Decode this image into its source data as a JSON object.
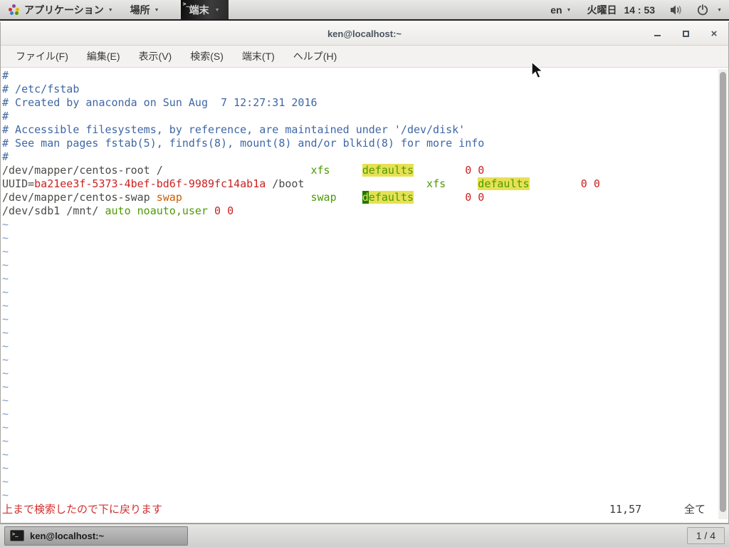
{
  "top_panel": {
    "applications_label": "アプリケーション",
    "places_label": "場所",
    "terminal_label": "端末",
    "language": "en",
    "day": "火曜日",
    "time": "14 : 53"
  },
  "icons": {
    "dropdown": "▼",
    "close": "×",
    "applications": "applications-grid-icon",
    "terminal": "terminal-icon",
    "speaker": "speaker-icon",
    "power": "power-icon"
  },
  "window": {
    "title": "ken@localhost:~"
  },
  "menubar": {
    "items": [
      "ファイル(F)",
      "編集(E)",
      "表示(V)",
      "検索(S)",
      "端末(T)",
      "ヘルプ(H)"
    ]
  },
  "terminal": {
    "lines": [
      {
        "segments": [
          {
            "text": "#",
            "style": "comment"
          }
        ]
      },
      {
        "segments": [
          {
            "text": "# /etc/fstab",
            "style": "comment"
          }
        ]
      },
      {
        "segments": [
          {
            "text": "# Created by anaconda on Sun Aug  7 12:27:31 2016",
            "style": "comment"
          }
        ]
      },
      {
        "segments": [
          {
            "text": "#",
            "style": "comment"
          }
        ]
      },
      {
        "segments": [
          {
            "text": "# Accessible filesystems, by reference, are maintained under '/dev/disk'",
            "style": "comment"
          }
        ]
      },
      {
        "segments": [
          {
            "text": "# See man pages fstab(5), findfs(8), mount(8) and/or blkid(8) for more info",
            "style": "comment"
          }
        ]
      },
      {
        "segments": [
          {
            "text": "#",
            "style": "comment"
          }
        ]
      },
      {
        "segments": [
          {
            "text": "/dev/mapper/centos-root /                       ",
            "style": "text"
          },
          {
            "text": "xfs",
            "style": "green"
          },
          {
            "text": "     ",
            "style": "text"
          },
          {
            "text": "defaults",
            "style": "hl"
          },
          {
            "text": "        ",
            "style": "text"
          },
          {
            "text": "0 0",
            "style": "red"
          }
        ]
      },
      {
        "segments": [
          {
            "text": "UUID=",
            "style": "text"
          },
          {
            "text": "ba21ee3f-5373-4bef-bd6f-9989fc14ab1a",
            "style": "red"
          },
          {
            "text": " /boot",
            "style": "text"
          },
          {
            "text": "                   ",
            "style": "text"
          },
          {
            "text": "xfs",
            "style": "green"
          },
          {
            "text": "     ",
            "style": "text"
          },
          {
            "text": "defaults",
            "style": "hl"
          },
          {
            "text": "        ",
            "style": "text"
          },
          {
            "text": "0 0",
            "style": "red"
          }
        ]
      },
      {
        "segments": [
          {
            "text": "/dev/mapper/centos-swap ",
            "style": "text"
          },
          {
            "text": "swap",
            "style": "orange"
          },
          {
            "text": "                    ",
            "style": "text"
          },
          {
            "text": "swap",
            "style": "green"
          },
          {
            "text": "    ",
            "style": "text"
          },
          {
            "text": "d",
            "style": "cursor"
          },
          {
            "text": "efaults",
            "style": "hl"
          },
          {
            "text": "        ",
            "style": "text"
          },
          {
            "text": "0 0",
            "style": "red"
          }
        ]
      },
      {
        "segments": [
          {
            "text": "/dev/sdb1 /mnt/ ",
            "style": "text"
          },
          {
            "text": "auto noauto,user",
            "style": "green"
          },
          {
            "text": " ",
            "style": "text"
          },
          {
            "text": "0 0",
            "style": "red"
          }
        ]
      },
      {
        "segments": [
          {
            "text": "~",
            "style": "tilde"
          }
        ]
      },
      {
        "segments": [
          {
            "text": "~",
            "style": "tilde"
          }
        ]
      },
      {
        "segments": [
          {
            "text": "~",
            "style": "tilde"
          }
        ]
      },
      {
        "segments": [
          {
            "text": "~",
            "style": "tilde"
          }
        ]
      },
      {
        "segments": [
          {
            "text": "~",
            "style": "tilde"
          }
        ]
      },
      {
        "segments": [
          {
            "text": "~",
            "style": "tilde"
          }
        ]
      },
      {
        "segments": [
          {
            "text": "~",
            "style": "tilde"
          }
        ]
      },
      {
        "segments": [
          {
            "text": "~",
            "style": "tilde"
          }
        ]
      },
      {
        "segments": [
          {
            "text": "~",
            "style": "tilde"
          }
        ]
      },
      {
        "segments": [
          {
            "text": "~",
            "style": "tilde"
          }
        ]
      },
      {
        "segments": [
          {
            "text": "~",
            "style": "tilde"
          }
        ]
      },
      {
        "segments": [
          {
            "text": "~",
            "style": "tilde"
          }
        ]
      },
      {
        "segments": [
          {
            "text": "~",
            "style": "tilde"
          }
        ]
      },
      {
        "segments": [
          {
            "text": "~",
            "style": "tilde"
          }
        ]
      },
      {
        "segments": [
          {
            "text": "~",
            "style": "tilde"
          }
        ]
      },
      {
        "segments": [
          {
            "text": "~",
            "style": "tilde"
          }
        ]
      },
      {
        "segments": [
          {
            "text": "~",
            "style": "tilde"
          }
        ]
      },
      {
        "segments": [
          {
            "text": "~",
            "style": "tilde"
          }
        ]
      },
      {
        "segments": [
          {
            "text": "~",
            "style": "tilde"
          }
        ]
      },
      {
        "segments": [
          {
            "text": "~",
            "style": "tilde"
          }
        ]
      },
      {
        "segments": [
          {
            "text": "~",
            "style": "tilde"
          }
        ]
      }
    ],
    "message": "上まで検索したので下に戻ります",
    "ruler": "11,57",
    "scope": "全て"
  },
  "taskbar": {
    "window_button_label": "ken@localhost:~",
    "pager_label": "1 / 4"
  },
  "colors": {
    "comment_blue": "#3f67a5",
    "syntax_green": "#4e9a06",
    "syntax_red": "#cb2222",
    "syntax_orange": "#ce5c00",
    "search_highlight": "#e6e153",
    "cursor_green": "#1f7a00",
    "message_red": "#d32f2f"
  }
}
